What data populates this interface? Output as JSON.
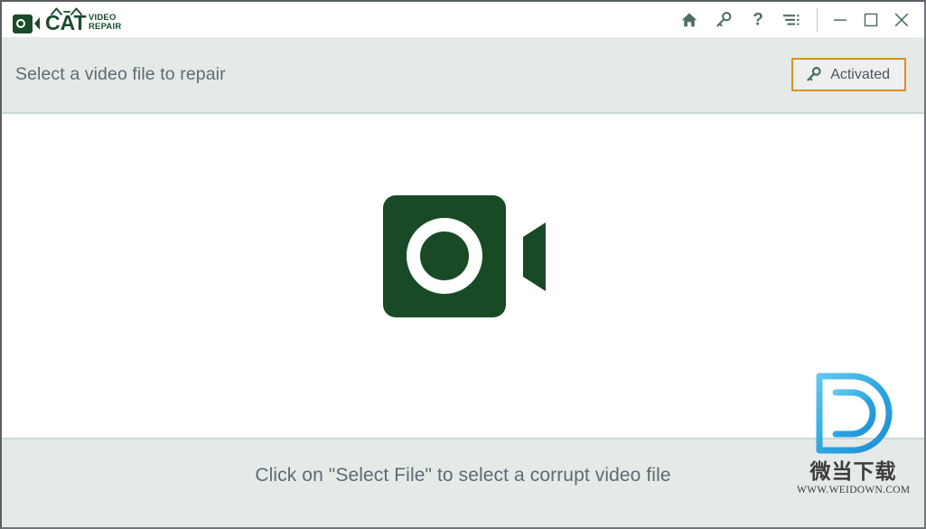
{
  "app": {
    "brand_name": "CAT",
    "brand_sub_line1": "VIDEO",
    "brand_sub_line2": "REPAIR"
  },
  "titlebar": {
    "icons": [
      {
        "name": "home-icon",
        "label": "Home"
      },
      {
        "name": "key-icon",
        "label": "Activation"
      },
      {
        "name": "help-icon",
        "label": "Help"
      },
      {
        "name": "menu-icon",
        "label": "Menu"
      }
    ],
    "window_controls": [
      {
        "name": "minimize-button",
        "label": "Minimize"
      },
      {
        "name": "maximize-button",
        "label": "Maximize"
      },
      {
        "name": "close-button",
        "label": "Close"
      }
    ]
  },
  "header": {
    "title": "Select a video file to repair",
    "activated_label": "Activated"
  },
  "main": {
    "camera_icon_name": "video-camera-icon",
    "select_file_label": "Select File"
  },
  "footer": {
    "hint": "Click on \"Select File\" to select a corrupt video file"
  },
  "watermark": {
    "letter": "D",
    "chinese": "微当下载",
    "url": "WWW.WEIDOWN.COM"
  },
  "colors": {
    "brand_green": "#1b4a2b",
    "icon_green": "#4e7060",
    "band_bg": "#e5eae8",
    "band_border": "#cbd8d2",
    "text_gray": "#5c6b73",
    "accent_orange": "#df8e1c",
    "watermark_blue": "#29a8e0"
  }
}
